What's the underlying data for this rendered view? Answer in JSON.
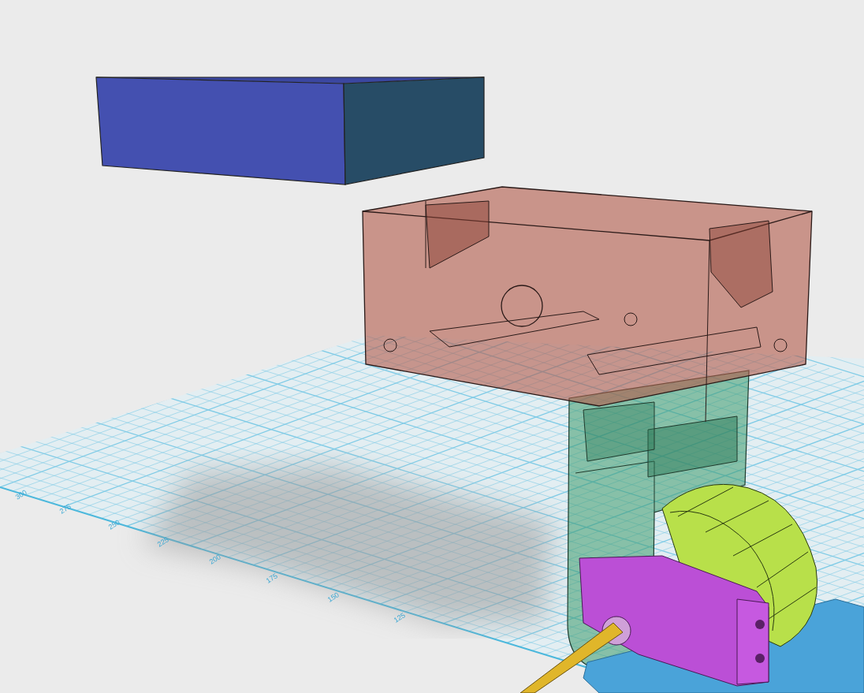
{
  "viewport": {
    "grid_labels": [
      "300",
      "275",
      "250",
      "225",
      "200",
      "175",
      "150",
      "125"
    ]
  }
}
